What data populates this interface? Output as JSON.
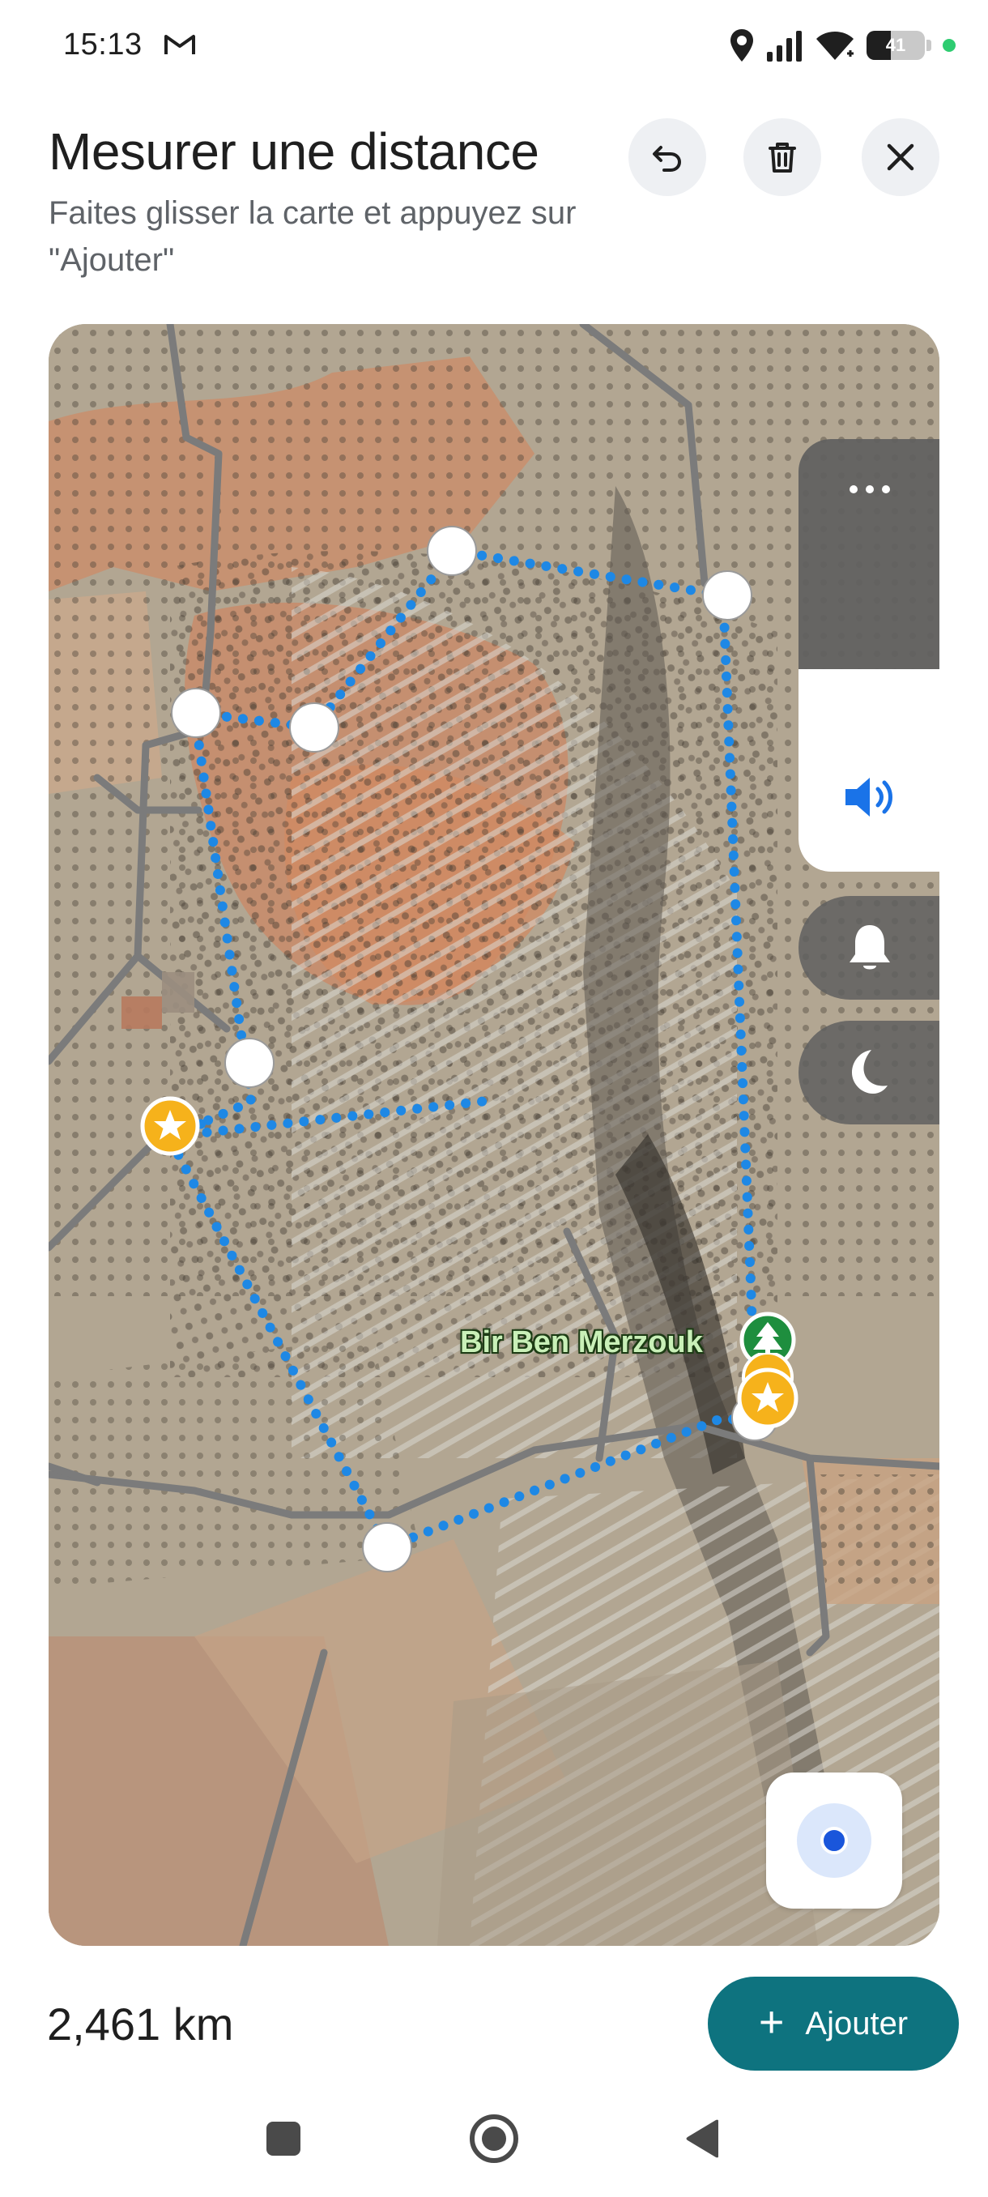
{
  "status_bar": {
    "time": "15:13",
    "battery_percent": "41",
    "battery_level": 0.41,
    "icons": [
      "gmail-icon",
      "location-icon",
      "signal-icon",
      "wifi-icon",
      "battery-icon"
    ]
  },
  "header": {
    "title": "Mesurer une distance",
    "subtitle": "Faites glisser la carte et appuyez sur \"Ajouter\"",
    "buttons": [
      "undo-icon",
      "delete-icon",
      "close-icon"
    ]
  },
  "map": {
    "place_label": "Bir Ben Merzouk",
    "route_color": "#2196f3",
    "pin_color": "#f6b21b",
    "controls": [
      "more-icon",
      "sound-icon",
      "bell-icon",
      "moon-icon",
      "my-location-icon"
    ]
  },
  "footer": {
    "distance": "2,461 km",
    "add_label": "Ajouter",
    "accent_color": "#0e737f"
  },
  "nav_bar": {
    "buttons": [
      "recents-icon",
      "home-icon",
      "back-icon"
    ]
  }
}
